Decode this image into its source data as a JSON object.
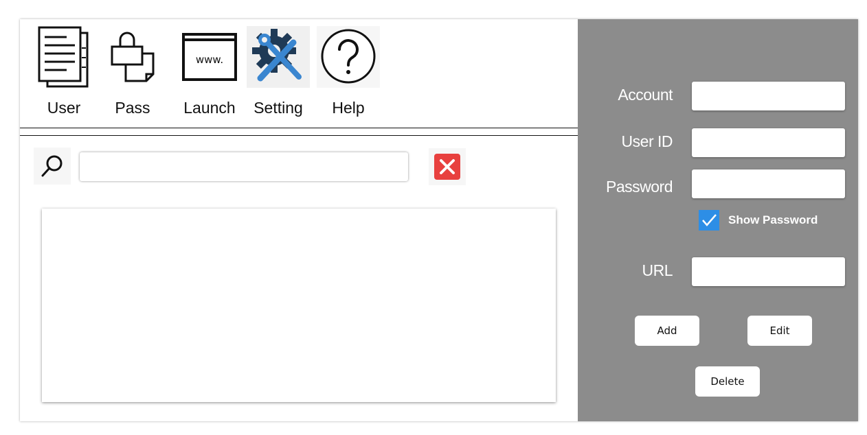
{
  "toolbar": {
    "items": [
      {
        "label": "User",
        "icon": "document-icon"
      },
      {
        "label": "Pass",
        "icon": "lock-icon"
      },
      {
        "label": "Launch",
        "icon": "browser-window-icon",
        "icon_text": "www."
      },
      {
        "label": "Setting",
        "icon": "gear-wrench-icon"
      },
      {
        "label": "Help",
        "icon": "question-mark-icon"
      }
    ]
  },
  "search": {
    "icon": "magnifier-icon",
    "value": "",
    "clear_icon": "red-x-icon"
  },
  "form": {
    "account_label": "Account",
    "account_value": "",
    "userid_label": "User ID",
    "userid_value": "",
    "password_label": "Password",
    "password_value": "",
    "show_password_label": "Show Password",
    "show_password_checked": true,
    "url_label": "URL",
    "url_value": ""
  },
  "buttons": {
    "add": "Add",
    "edit": "Edit",
    "delete": "Delete"
  },
  "colors": {
    "panel": "#8c8c8c",
    "accent_blue": "#2d8ee6",
    "danger_red": "#e8403e"
  }
}
